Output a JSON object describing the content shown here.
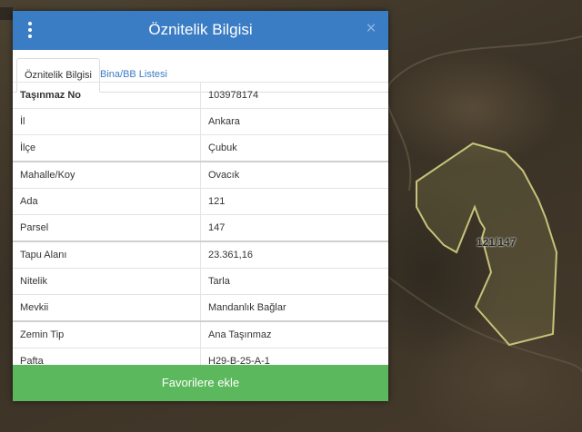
{
  "panel": {
    "title": "Öznitelik Bilgisi",
    "close_symbol": "×",
    "tabs": [
      {
        "label": "Öznitelik Bilgisi",
        "active": true
      },
      {
        "label": "Bina/BB Listesi",
        "active": false
      }
    ],
    "rows": [
      {
        "key": "Taşınmaz No",
        "value": "103978174"
      },
      {
        "key": "İl",
        "value": "Ankara"
      },
      {
        "key": "İlçe",
        "value": "Çubuk"
      },
      {
        "key": "Mahalle/Koy",
        "value": "Ovacık"
      },
      {
        "key": "Ada",
        "value": "121"
      },
      {
        "key": "Parsel",
        "value": "147"
      },
      {
        "key": "Tapu Alanı",
        "value": "23.361,16"
      },
      {
        "key": "Nitelik",
        "value": "Tarla"
      },
      {
        "key": "Mevkii",
        "value": "Mandanlık Bağlar"
      },
      {
        "key": "Zemin Tip",
        "value": "Ana Taşınmaz"
      },
      {
        "key": "Pafta",
        "value": "H29-B-25-A-1"
      }
    ],
    "favorite_button": "Favorilere ekle"
  },
  "map": {
    "parcel_label": "121/147"
  },
  "icons": {
    "menu": "kebab-menu-icon",
    "close": "close-icon"
  },
  "colors": {
    "header": "#3a7dc5",
    "favorite_button": "#5cb85c",
    "parcel_outline": "#c8c27a"
  }
}
